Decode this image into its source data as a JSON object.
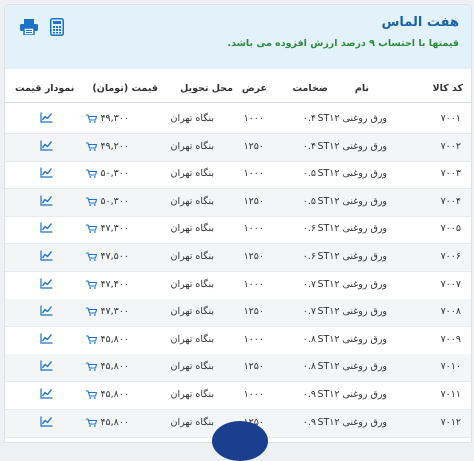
{
  "header": {
    "title": "هفت الماس",
    "subtitle": "قیمتها با احتساب ۹ درصد ارزش افزوده می باشد.",
    "icons": {
      "print": "printer-icon",
      "calc": "calculator-icon"
    },
    "colors": {
      "title": "#1a64a8",
      "subtitle": "#2e8a3a",
      "background": "#e3f2fa"
    }
  },
  "table": {
    "columns": {
      "code": "کد کالا",
      "name": "نام",
      "thickness": "ضخامت",
      "width": "عرض",
      "location": "محل تحویل",
      "price": "قیمت (تومان)",
      "chart": "نمودار قیمت"
    },
    "rows": [
      {
        "code": "۷۰۰۱",
        "name": "ورق روغنی ST۱۲",
        "thickness": "۰.۴",
        "width": "۱۰۰۰",
        "location": "بنگاه تهران",
        "price": "۴۹,۳۰۰"
      },
      {
        "code": "۷۰۰۲",
        "name": "ورق روغنی ST۱۲",
        "thickness": "۰.۴",
        "width": "۱۲۵۰",
        "location": "بنگاه تهران",
        "price": "۴۹,۲۰۰"
      },
      {
        "code": "۷۰۰۳",
        "name": "ورق روغنی ST۱۲",
        "thickness": "۰.۵",
        "width": "۱۰۰۰",
        "location": "بنگاه تهران",
        "price": "۵۰,۳۰۰"
      },
      {
        "code": "۷۰۰۴",
        "name": "ورق روغنی ST۱۲",
        "thickness": "۰.۵",
        "width": "۱۲۵۰",
        "location": "بنگاه تهران",
        "price": "۵۰,۳۰۰"
      },
      {
        "code": "۷۰۰۵",
        "name": "ورق روغنی ST۱۲",
        "thickness": "۰.۶",
        "width": "۱۰۰۰",
        "location": "بنگاه تهران",
        "price": "۴۷,۳۰۰"
      },
      {
        "code": "۷۰۰۶",
        "name": "ورق روغنی ST۱۲",
        "thickness": "۰.۶",
        "width": "۱۲۵۰",
        "location": "بنگاه تهران",
        "price": "۴۷,۵۰۰"
      },
      {
        "code": "۷۰۰۷",
        "name": "ورق روغنی ST۱۲",
        "thickness": "۰.۷",
        "width": "۱۰۰۰",
        "location": "بنگاه تهران",
        "price": "۴۷,۴۰۰"
      },
      {
        "code": "۷۰۰۸",
        "name": "ورق روغنی ST۱۲",
        "thickness": "۰.۷",
        "width": "۱۲۵۰",
        "location": "بنگاه تهران",
        "price": "۴۷,۳۰۰"
      },
      {
        "code": "۷۰۰۹",
        "name": "ورق روغنی ST۱۲",
        "thickness": "۰.۸",
        "width": "۱۰۰۰",
        "location": "بنگاه تهران",
        "price": "۴۵,۸۰۰"
      },
      {
        "code": "۷۰۱۰",
        "name": "ورق روغنی ST۱۲",
        "thickness": "۰.۸",
        "width": "۱۲۵۰",
        "location": "بنگاه تهران",
        "price": "۴۵,۸۰۰"
      },
      {
        "code": "۷۰۱۱",
        "name": "ورق روغنی ST۱۲",
        "thickness": "۰.۹",
        "width": "۱۰۰۰",
        "location": "بنگاه تهران",
        "price": "۴۵,۸۰۰"
      },
      {
        "code": "۷۰۱۲",
        "name": "ورق روغنی ST۱۲",
        "thickness": "۰.۹",
        "width": "۱۲۵۰",
        "location": "بنگاه تهران",
        "price": "۴۵,۸۰۰"
      }
    ],
    "row_icons": {
      "price": "cart-icon",
      "chart": "chart-line-icon"
    },
    "colors": {
      "icon": "#1a73c9",
      "alt_row": "#f4f5f7"
    }
  },
  "floating_button": {
    "icon": "fab-button",
    "color": "#1a3f8f"
  }
}
